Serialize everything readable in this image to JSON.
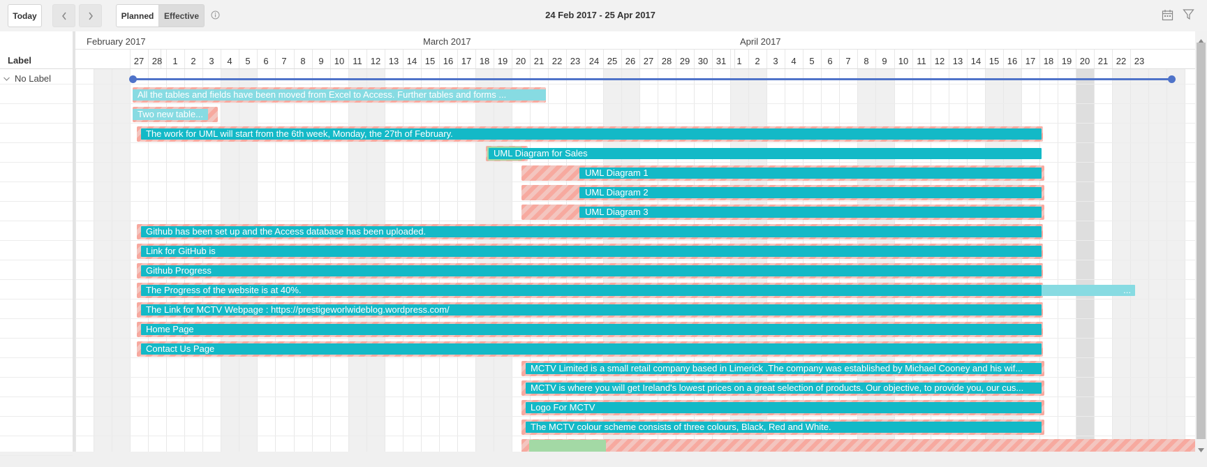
{
  "toolbar": {
    "today_label": "Today",
    "prev_label": "‹",
    "next_label": "›",
    "planned_label": "Planned",
    "effective_label": "Effective",
    "info_icon": "info-icon",
    "date_range": "24 Feb 2017 - 25 Apr 2017",
    "calendar_icon": "calendar-icon",
    "filter_icon": "filter-icon"
  },
  "left_panel": {
    "header": "Label",
    "group_label": "No Label",
    "chevron_icon": "chevron-down-icon"
  },
  "timeline": {
    "months": [
      "February 2017",
      "March 2017",
      "April 2017"
    ],
    "days": [
      "27",
      "28",
      "1",
      "2",
      "3",
      "4",
      "5",
      "6",
      "7",
      "8",
      "9",
      "10",
      "11",
      "12",
      "13",
      "14",
      "15",
      "16",
      "17",
      "18",
      "19",
      "20",
      "21",
      "22",
      "23",
      "24",
      "25",
      "26",
      "27",
      "28",
      "29",
      "30",
      "31",
      "1",
      "2",
      "3",
      "4",
      "5",
      "6",
      "7",
      "8",
      "9",
      "10",
      "11",
      "12",
      "13",
      "14",
      "15",
      "16",
      "17",
      "18",
      "19",
      "20",
      "21",
      "22",
      "23"
    ]
  },
  "tasks": [
    {
      "label": "All the tables and fields have been moved from Excel to Access. Further tables and forms ..."
    },
    {
      "label": "Two new table..."
    },
    {
      "label": "The work for UML will start from the 6th week, Monday, the 27th of February."
    },
    {
      "label": "UML Diagram for Sales"
    },
    {
      "label": "UML Diagram 1"
    },
    {
      "label": "UML Diagram 2"
    },
    {
      "label": "UML Diagram 3"
    },
    {
      "label": "Github has been set up and the Access database has been uploaded."
    },
    {
      "label": "Link for GitHub is"
    },
    {
      "label": "Github Progress"
    },
    {
      "label": "The Progress of the website is at 40%.",
      "trailing": "..."
    },
    {
      "label": "The Link for MCTV Webpage : https://prestigeworlwideblog.wordpress.com/"
    },
    {
      "label": "Home Page"
    },
    {
      "label": "Contact Us Page"
    },
    {
      "label": "MCTV Limited is a small retail company based in Limerick .The company was established by Michael Cooney and his wif..."
    },
    {
      "label": "MCTV is where you will get Ireland's lowest prices on a great selection of products. Our objective, to provide you, our cus..."
    },
    {
      "label": "Logo For MCTV"
    },
    {
      "label": "The MCTV colour scheme consists of three colours, Black, Red and White."
    }
  ],
  "colors": {
    "effective": "#13b9c7",
    "planned_stripe": "#f7a99f",
    "summary": "#4f73c9",
    "weekend": "#f0f0f0"
  }
}
